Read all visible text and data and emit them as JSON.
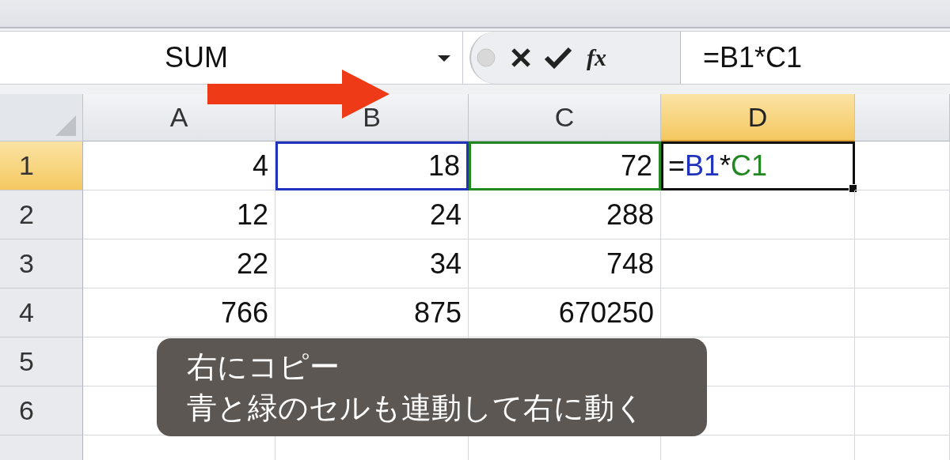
{
  "name_box": {
    "value": "SUM"
  },
  "formula_bar": {
    "fx_label": "fx",
    "value": "=B1*C1"
  },
  "columns": [
    {
      "label": "A",
      "selected": false
    },
    {
      "label": "B",
      "selected": false
    },
    {
      "label": "C",
      "selected": false
    },
    {
      "label": "D",
      "selected": true
    }
  ],
  "rows": [
    {
      "label": "1",
      "selected": true,
      "cells": [
        {
          "value": "4"
        },
        {
          "value": "18",
          "color": "#2233bb"
        },
        {
          "value": "72",
          "color": "#228822"
        },
        {
          "kind": "formula",
          "active": true,
          "parts": [
            {
              "text": "=",
              "color": "#111111"
            },
            {
              "text": "B1",
              "color": "#2233bb"
            },
            {
              "text": "*",
              "color": "#111111"
            },
            {
              "text": "C1",
              "color": "#228822"
            }
          ]
        }
      ]
    },
    {
      "label": "2",
      "selected": false,
      "cells": [
        {
          "value": "12"
        },
        {
          "value": "24"
        },
        {
          "value": "288"
        },
        {}
      ]
    },
    {
      "label": "3",
      "selected": false,
      "cells": [
        {
          "value": "22"
        },
        {
          "value": "34"
        },
        {
          "value": "748"
        },
        {}
      ]
    },
    {
      "label": "4",
      "selected": false,
      "cells": [
        {
          "value": "766"
        },
        {
          "value": "875"
        },
        {
          "value": "670250"
        },
        {}
      ]
    },
    {
      "label": "5",
      "selected": false,
      "cells": [
        {},
        {},
        {},
        {}
      ]
    },
    {
      "label": "6",
      "selected": false,
      "cells": [
        {},
        {},
        {},
        {}
      ]
    }
  ],
  "caption": {
    "lines": [
      "右にコピー",
      "青と緑のセルも連動して右に動く"
    ]
  }
}
